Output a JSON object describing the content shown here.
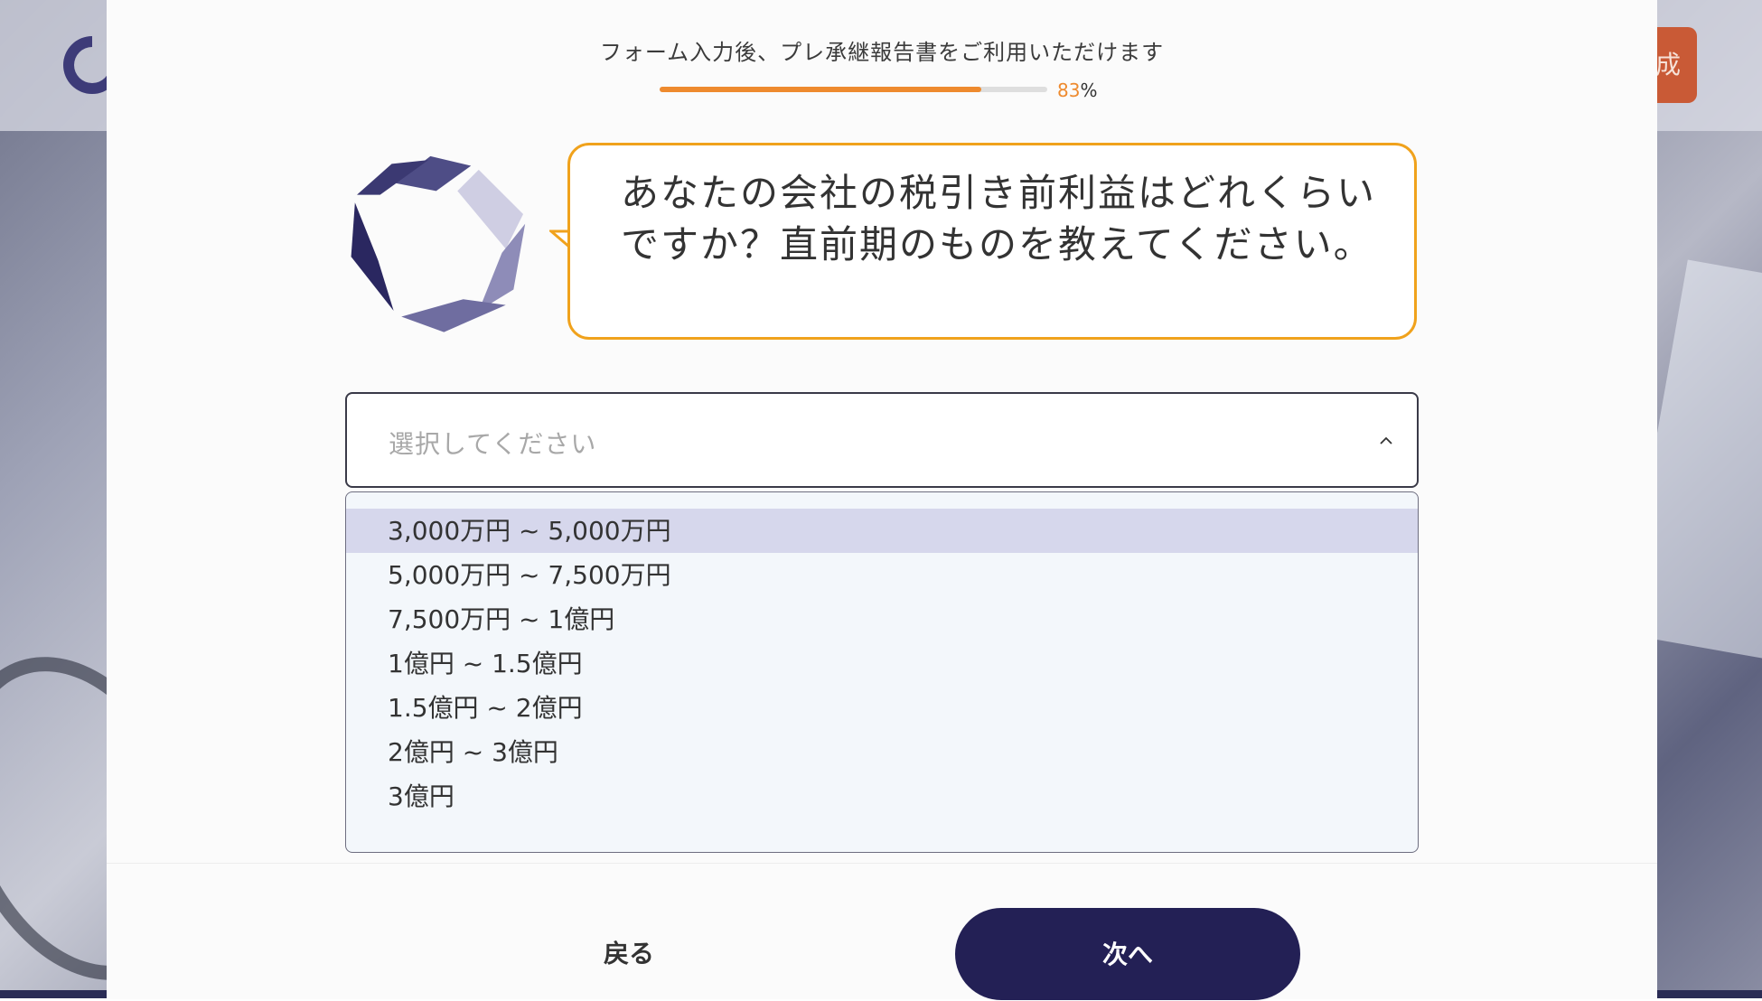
{
  "background": {
    "cta_partial_label": "成"
  },
  "progress": {
    "caption": "フォーム入力後、プレ承継報告書をご利用いただけます",
    "value": 83,
    "percent_sign": "%",
    "fill_color": "#ee8a2e"
  },
  "avatar": {
    "icon": "company-logo-icon",
    "colors": [
      "#2a2760",
      "#4e4d86",
      "#7c7aab",
      "#a6a5c9",
      "#cfcee3"
    ]
  },
  "question": {
    "text": "あなたの会社の税引き前利益はどれくらいですか？直前期のものを教えてください。",
    "border_color": "#f0a21c"
  },
  "select": {
    "placeholder": "選択してください",
    "icon": "chevron-up-icon",
    "options": [
      "3,000万円 ~ 5,000万円",
      "5,000万円 ~ 7,500万円",
      "7,500万円 ~ 1億円",
      "1億円 ~ 1.5億円",
      "1.5億円 ~ 2億円",
      "2億円 ~ 3億円",
      "3億円"
    ],
    "highlighted_index": 0,
    "highlight_color": "#d6d7ec"
  },
  "footer": {
    "back_label": "戻る",
    "next_label": "次へ",
    "next_color": "#232055"
  }
}
